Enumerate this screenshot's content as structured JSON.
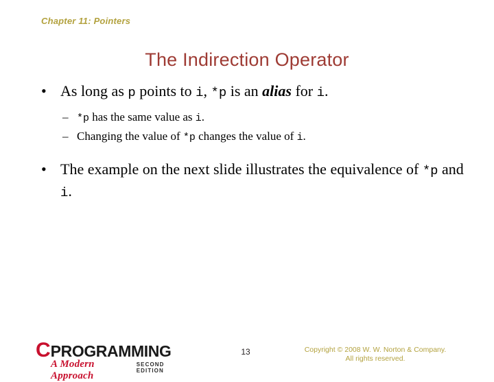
{
  "slide": {
    "chapter_header": "Chapter 11: Pointers",
    "title": "The Indirection Operator",
    "page_number": "13",
    "bullet_marker": "•",
    "subbullet_marker": "–"
  },
  "content": {
    "bullet1": {
      "t1": "As long as ",
      "c1": "p",
      "t2": " points to ",
      "c2": "i",
      "t3": ", ",
      "c3": "*p",
      "t4": " is an ",
      "emph": "alias",
      "t5": " for ",
      "c4": "i",
      "t6": "."
    },
    "sub1": {
      "c1": "*p",
      "t1": " has the same value as ",
      "c2": "i",
      "t2": "."
    },
    "sub2": {
      "t1": "Changing the value of ",
      "c1": "*p",
      "t2": " changes the value of ",
      "c2": "i",
      "t3": "."
    },
    "bullet2": {
      "t1": "The example on the next slide illustrates the equivalence of ",
      "c1": "*p",
      "t2": " and ",
      "c2": "i",
      "t3": "."
    }
  },
  "footer": {
    "logo_c": "C",
    "logo_word": "PROGRAMMING",
    "logo_subtitle": "A Modern Approach",
    "logo_edition": "SECOND EDITION",
    "copyright_line1": "Copyright © 2008 W. W. Norton & Company.",
    "copyright_line2": "All rights reserved."
  },
  "colors": {
    "header_olive": "#b3a23f",
    "title_red": "#9e3b34",
    "logo_red": "#c8102e",
    "body_black": "#000000",
    "background": "#ffffff"
  }
}
